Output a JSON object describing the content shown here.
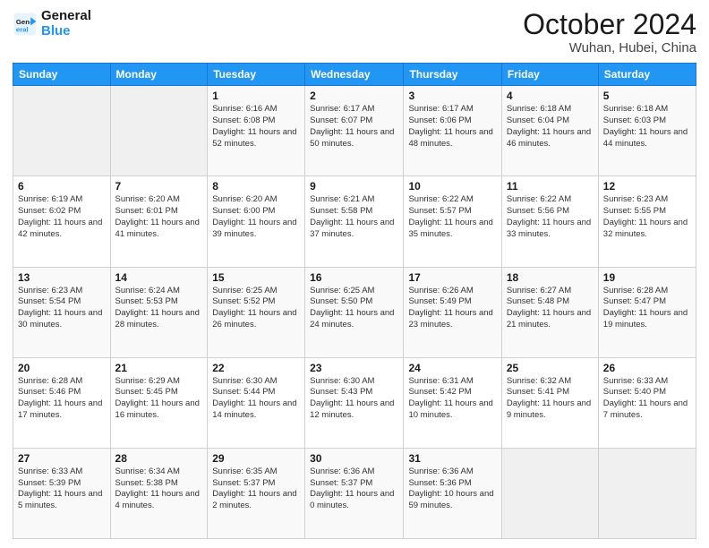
{
  "header": {
    "logo_line1": "General",
    "logo_line2": "Blue",
    "month": "October 2024",
    "location": "Wuhan, Hubei, China"
  },
  "weekdays": [
    "Sunday",
    "Monday",
    "Tuesday",
    "Wednesday",
    "Thursday",
    "Friday",
    "Saturday"
  ],
  "weeks": [
    [
      {
        "day": "",
        "sunrise": "",
        "sunset": "",
        "daylight": ""
      },
      {
        "day": "",
        "sunrise": "",
        "sunset": "",
        "daylight": ""
      },
      {
        "day": "1",
        "sunrise": "Sunrise: 6:16 AM",
        "sunset": "Sunset: 6:08 PM",
        "daylight": "Daylight: 11 hours and 52 minutes."
      },
      {
        "day": "2",
        "sunrise": "Sunrise: 6:17 AM",
        "sunset": "Sunset: 6:07 PM",
        "daylight": "Daylight: 11 hours and 50 minutes."
      },
      {
        "day": "3",
        "sunrise": "Sunrise: 6:17 AM",
        "sunset": "Sunset: 6:06 PM",
        "daylight": "Daylight: 11 hours and 48 minutes."
      },
      {
        "day": "4",
        "sunrise": "Sunrise: 6:18 AM",
        "sunset": "Sunset: 6:04 PM",
        "daylight": "Daylight: 11 hours and 46 minutes."
      },
      {
        "day": "5",
        "sunrise": "Sunrise: 6:18 AM",
        "sunset": "Sunset: 6:03 PM",
        "daylight": "Daylight: 11 hours and 44 minutes."
      }
    ],
    [
      {
        "day": "6",
        "sunrise": "Sunrise: 6:19 AM",
        "sunset": "Sunset: 6:02 PM",
        "daylight": "Daylight: 11 hours and 42 minutes."
      },
      {
        "day": "7",
        "sunrise": "Sunrise: 6:20 AM",
        "sunset": "Sunset: 6:01 PM",
        "daylight": "Daylight: 11 hours and 41 minutes."
      },
      {
        "day": "8",
        "sunrise": "Sunrise: 6:20 AM",
        "sunset": "Sunset: 6:00 PM",
        "daylight": "Daylight: 11 hours and 39 minutes."
      },
      {
        "day": "9",
        "sunrise": "Sunrise: 6:21 AM",
        "sunset": "Sunset: 5:58 PM",
        "daylight": "Daylight: 11 hours and 37 minutes."
      },
      {
        "day": "10",
        "sunrise": "Sunrise: 6:22 AM",
        "sunset": "Sunset: 5:57 PM",
        "daylight": "Daylight: 11 hours and 35 minutes."
      },
      {
        "day": "11",
        "sunrise": "Sunrise: 6:22 AM",
        "sunset": "Sunset: 5:56 PM",
        "daylight": "Daylight: 11 hours and 33 minutes."
      },
      {
        "day": "12",
        "sunrise": "Sunrise: 6:23 AM",
        "sunset": "Sunset: 5:55 PM",
        "daylight": "Daylight: 11 hours and 32 minutes."
      }
    ],
    [
      {
        "day": "13",
        "sunrise": "Sunrise: 6:23 AM",
        "sunset": "Sunset: 5:54 PM",
        "daylight": "Daylight: 11 hours and 30 minutes."
      },
      {
        "day": "14",
        "sunrise": "Sunrise: 6:24 AM",
        "sunset": "Sunset: 5:53 PM",
        "daylight": "Daylight: 11 hours and 28 minutes."
      },
      {
        "day": "15",
        "sunrise": "Sunrise: 6:25 AM",
        "sunset": "Sunset: 5:52 PM",
        "daylight": "Daylight: 11 hours and 26 minutes."
      },
      {
        "day": "16",
        "sunrise": "Sunrise: 6:25 AM",
        "sunset": "Sunset: 5:50 PM",
        "daylight": "Daylight: 11 hours and 24 minutes."
      },
      {
        "day": "17",
        "sunrise": "Sunrise: 6:26 AM",
        "sunset": "Sunset: 5:49 PM",
        "daylight": "Daylight: 11 hours and 23 minutes."
      },
      {
        "day": "18",
        "sunrise": "Sunrise: 6:27 AM",
        "sunset": "Sunset: 5:48 PM",
        "daylight": "Daylight: 11 hours and 21 minutes."
      },
      {
        "day": "19",
        "sunrise": "Sunrise: 6:28 AM",
        "sunset": "Sunset: 5:47 PM",
        "daylight": "Daylight: 11 hours and 19 minutes."
      }
    ],
    [
      {
        "day": "20",
        "sunrise": "Sunrise: 6:28 AM",
        "sunset": "Sunset: 5:46 PM",
        "daylight": "Daylight: 11 hours and 17 minutes."
      },
      {
        "day": "21",
        "sunrise": "Sunrise: 6:29 AM",
        "sunset": "Sunset: 5:45 PM",
        "daylight": "Daylight: 11 hours and 16 minutes."
      },
      {
        "day": "22",
        "sunrise": "Sunrise: 6:30 AM",
        "sunset": "Sunset: 5:44 PM",
        "daylight": "Daylight: 11 hours and 14 minutes."
      },
      {
        "day": "23",
        "sunrise": "Sunrise: 6:30 AM",
        "sunset": "Sunset: 5:43 PM",
        "daylight": "Daylight: 11 hours and 12 minutes."
      },
      {
        "day": "24",
        "sunrise": "Sunrise: 6:31 AM",
        "sunset": "Sunset: 5:42 PM",
        "daylight": "Daylight: 11 hours and 10 minutes."
      },
      {
        "day": "25",
        "sunrise": "Sunrise: 6:32 AM",
        "sunset": "Sunset: 5:41 PM",
        "daylight": "Daylight: 11 hours and 9 minutes."
      },
      {
        "day": "26",
        "sunrise": "Sunrise: 6:33 AM",
        "sunset": "Sunset: 5:40 PM",
        "daylight": "Daylight: 11 hours and 7 minutes."
      }
    ],
    [
      {
        "day": "27",
        "sunrise": "Sunrise: 6:33 AM",
        "sunset": "Sunset: 5:39 PM",
        "daylight": "Daylight: 11 hours and 5 minutes."
      },
      {
        "day": "28",
        "sunrise": "Sunrise: 6:34 AM",
        "sunset": "Sunset: 5:38 PM",
        "daylight": "Daylight: 11 hours and 4 minutes."
      },
      {
        "day": "29",
        "sunrise": "Sunrise: 6:35 AM",
        "sunset": "Sunset: 5:37 PM",
        "daylight": "Daylight: 11 hours and 2 minutes."
      },
      {
        "day": "30",
        "sunrise": "Sunrise: 6:36 AM",
        "sunset": "Sunset: 5:37 PM",
        "daylight": "Daylight: 11 hours and 0 minutes."
      },
      {
        "day": "31",
        "sunrise": "Sunrise: 6:36 AM",
        "sunset": "Sunset: 5:36 PM",
        "daylight": "Daylight: 10 hours and 59 minutes."
      },
      {
        "day": "",
        "sunrise": "",
        "sunset": "",
        "daylight": ""
      },
      {
        "day": "",
        "sunrise": "",
        "sunset": "",
        "daylight": ""
      }
    ]
  ]
}
